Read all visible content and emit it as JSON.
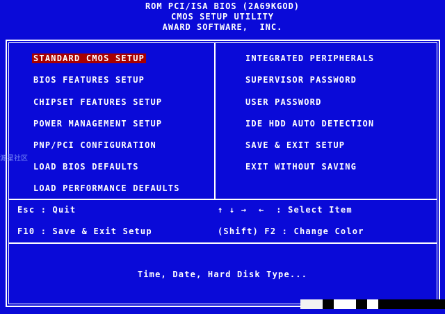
{
  "header": {
    "line1": "ROM PCI/ISA BIOS (2A69KGOD)",
    "line2": "CMOS SETUP UTILITY",
    "line3": "AWARD SOFTWARE,  INC."
  },
  "menu": {
    "left": [
      {
        "label": "STANDARD CMOS SETUP",
        "selected": true
      },
      {
        "label": "BIOS FEATURES SETUP"
      },
      {
        "label": "CHIPSET FEATURES SETUP"
      },
      {
        "label": "POWER MANAGEMENT SETUP"
      },
      {
        "label": "PNP/PCI CONFIGURATION"
      },
      {
        "label": "LOAD BIOS DEFAULTS"
      },
      {
        "label": "LOAD PERFORMANCE DEFAULTS"
      }
    ],
    "right": [
      {
        "label": "INTEGRATED PERIPHERALS"
      },
      {
        "label": "SUPERVISOR PASSWORD"
      },
      {
        "label": "USER PASSWORD"
      },
      {
        "label": "IDE HDD AUTO DETECTION"
      },
      {
        "label": "SAVE & EXIT SETUP"
      },
      {
        "label": "EXIT WITHOUT SAVING"
      }
    ]
  },
  "help": {
    "esc": "Esc : Quit",
    "f10": "F10 : Save & Exit Setup",
    "arrows": "↑ ↓ →  ←  : Select Item",
    "shift_f2": "(Shift) F2 : Change Color"
  },
  "status": {
    "text": "Time, Date, Hard Disk Type..."
  },
  "watermark": {
    "text": "源星社区"
  },
  "colors": {
    "background": "#0a0ad8",
    "selected_bg": "#a80000",
    "text": "#ffffff"
  }
}
